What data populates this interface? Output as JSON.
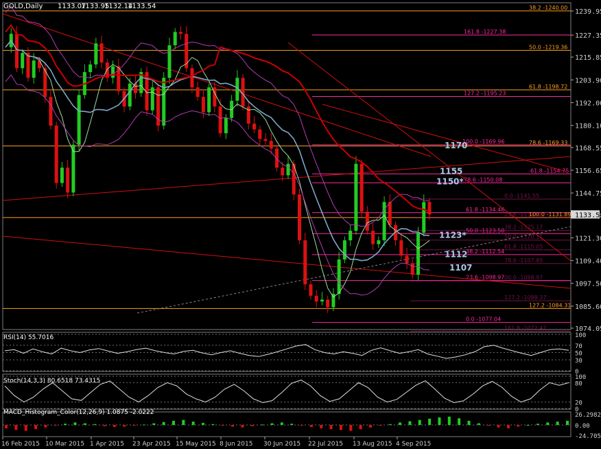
{
  "chart_data": {
    "type": "candlestick",
    "symbol_header": "GOLD,Daily",
    "ohlc_readout": [
      "1133.07",
      "1133.95",
      "1132.14",
      "1133.54"
    ],
    "current_price": "1133.54",
    "y_ticks": [
      "1239.95",
      "1227.35",
      "1215.85",
      "1203.90",
      "1192.00",
      "1180.10",
      "1168.55",
      "1156.65",
      "1144.75",
      "1133.20",
      "1121.30",
      "1109.40",
      "1097.50",
      "1085.60",
      "1074.05"
    ],
    "ylim": [
      1070,
      1243
    ],
    "x_labels": [
      "16 Feb 2015",
      "10 Mar 2015",
      "1 Apr 2015",
      "23 Apr 2015",
      "15 May 2015",
      "8 Jun 2015",
      "30 Jun 2015",
      "22 Jul 2015",
      "13 Aug 2015",
      "4 Sep 2015"
    ],
    "colors": {
      "bull": "#22cc22",
      "bear": "#dd1111",
      "fib_major": "#ffa020",
      "fib_minor": "#ff2aa0",
      "ma_slow": "#cc0000",
      "ma_mid": "#7fa8c8",
      "bands": "#b43cb4",
      "ma_fast": "#9fdf9f"
    },
    "price_path": [
      1221,
      1228,
      1210,
      1218,
      1205,
      1214,
      1210,
      1195,
      1180,
      1150,
      1158,
      1145,
      1170,
      1196,
      1208,
      1212,
      1223,
      1213,
      1205,
      1211,
      1198,
      1190,
      1202,
      1197,
      1208,
      1188,
      1200,
      1180,
      1205,
      1222,
      1229,
      1228,
      1210,
      1200,
      1195,
      1187,
      1200,
      1190,
      1176,
      1184,
      1193,
      1205,
      1190,
      1181,
      1178,
      1173,
      1172,
      1168,
      1158,
      1154,
      1160,
      1144,
      1120,
      1097,
      1091,
      1088,
      1089,
      1085,
      1092,
      1110,
      1120,
      1125,
      1160,
      1135,
      1125,
      1118,
      1120,
      1140,
      1128,
      1120,
      1112,
      1108,
      1102,
      1124,
      1140,
      1133.5
    ],
    "fib_levels": [
      {
        "label": "38.2 -1240.00",
        "value": 1240.0,
        "tier": "major"
      },
      {
        "label": "161.8 -1227.38",
        "value": 1227.38,
        "tier": "minor"
      },
      {
        "label": "50.0 -1219.36",
        "value": 1219.36,
        "tier": "major"
      },
      {
        "label": "61.8 -1198.72",
        "value": 1198.72,
        "tier": "major"
      },
      {
        "label": "127.2 -1195.23",
        "value": 1195.23,
        "tier": "minor"
      },
      {
        "label": "100.0 -1169.96",
        "value": 1169.96,
        "tier": "minor"
      },
      {
        "label": "78.6 -1169.33",
        "value": 1169.33,
        "tier": "major"
      },
      {
        "label": "61.8 -1154.75",
        "value": 1154.75,
        "tier": "minor"
      },
      {
        "label": "78.6 -1150.08",
        "value": 1150.08,
        "tier": "minor"
      },
      {
        "label": "0.0 -1141.55",
        "value": 1141.55,
        "tier": "dim"
      },
      {
        "label": "61.8 -1134.46",
        "value": 1134.46,
        "tier": "minor"
      },
      {
        "label": "100.0 -1131.89",
        "value": 1131.89,
        "tier": "major"
      },
      {
        "label": "23.6 -1131.89",
        "value": 1131.8,
        "tier": "dim"
      },
      {
        "label": "38.2 -1125.17",
        "value": 1125.17,
        "tier": "dim"
      },
      {
        "label": "50.0 -1123.50",
        "value": 1123.5,
        "tier": "minor"
      },
      {
        "label": "50.0 -1120.11",
        "value": 1120.11,
        "tier": "dim"
      },
      {
        "label": "61.8 -1115.05",
        "value": 1115.05,
        "tier": "dim"
      },
      {
        "label": "38.2 -1112.54",
        "value": 1112.54,
        "tier": "minor"
      },
      {
        "label": "78.6 -1107.85",
        "value": 1107.85,
        "tier": "dim"
      },
      {
        "label": "23.6 -1098.97",
        "value": 1098.97,
        "tier": "minor"
      },
      {
        "label": "00.0 -1098.97",
        "value": 1098.8,
        "tier": "dim"
      },
      {
        "label": "127.2 -1088.37",
        "value": 1088.37,
        "tier": "dim"
      },
      {
        "label": "127.2 -1084.31",
        "value": 1084.31,
        "tier": "major"
      },
      {
        "label": "0.0 -1077.04",
        "value": 1077.04,
        "tier": "minor"
      },
      {
        "label": "161.8 -1072.47",
        "value": 1072.47,
        "tier": "dim"
      }
    ],
    "level_notes": [
      {
        "text": "1170",
        "value": 1170
      },
      {
        "text": "1155",
        "value": 1156.5
      },
      {
        "text": "1150*",
        "value": 1151
      },
      {
        "text": "1123*",
        "value": 1123
      },
      {
        "text": "1112",
        "value": 1113
      },
      {
        "text": "1107",
        "value": 1106
      }
    ],
    "rsi": {
      "label": "RSI(14) 55.7016",
      "ticks": [
        "100",
        "70",
        "50",
        "30",
        "0"
      ],
      "values": [
        55,
        58,
        48,
        60,
        52,
        46,
        62,
        55,
        50,
        57,
        61,
        54,
        48,
        52,
        58,
        62,
        55,
        50,
        46,
        53,
        56,
        49,
        44,
        50,
        55,
        48,
        42,
        39,
        45,
        52,
        60,
        68,
        72,
        58,
        50,
        46,
        52,
        48,
        42,
        56,
        63,
        55,
        48,
        52,
        58,
        46,
        40,
        34,
        38,
        44,
        52,
        66,
        70,
        62,
        55,
        48,
        42,
        50,
        58,
        60,
        56
      ]
    },
    "stoch": {
      "label": "Stoch(14,3,3) 80.6518 73.4315",
      "ticks": [
        "100",
        "80",
        "20",
        "0"
      ],
      "values": [
        70,
        40,
        20,
        35,
        60,
        80,
        55,
        30,
        25,
        50,
        75,
        85,
        60,
        35,
        20,
        40,
        65,
        80,
        70,
        45,
        30,
        20,
        35,
        60,
        75,
        55,
        30,
        18,
        25,
        50,
        78,
        88,
        70,
        40,
        22,
        30,
        55,
        80,
        65,
        35,
        20,
        28,
        50,
        72,
        86,
        60,
        32,
        18,
        24,
        45,
        70,
        84,
        66,
        38,
        20,
        30,
        58,
        80,
        72,
        80
      ]
    },
    "macd": {
      "label": "MACD_Histogram_Color(12,26,9) 1.0875 -2.0222",
      "ticks": [
        "26.2982",
        "0.00",
        "-24.7053"
      ],
      "values": [
        -8,
        -12,
        -14,
        -10,
        -6,
        -2,
        3,
        6,
        4,
        2,
        -3,
        -5,
        -4,
        -2,
        1,
        4,
        7,
        10,
        12,
        8,
        5,
        2,
        -2,
        -4,
        -6,
        -3,
        1,
        4,
        6,
        3,
        -2,
        -5,
        -8,
        -10,
        -12,
        -14,
        -10,
        -6,
        -2,
        2,
        6,
        9,
        12,
        15,
        18,
        20,
        16,
        10,
        4,
        -2,
        -6,
        -8,
        -4,
        0,
        3,
        6,
        8,
        10
      ]
    }
  }
}
